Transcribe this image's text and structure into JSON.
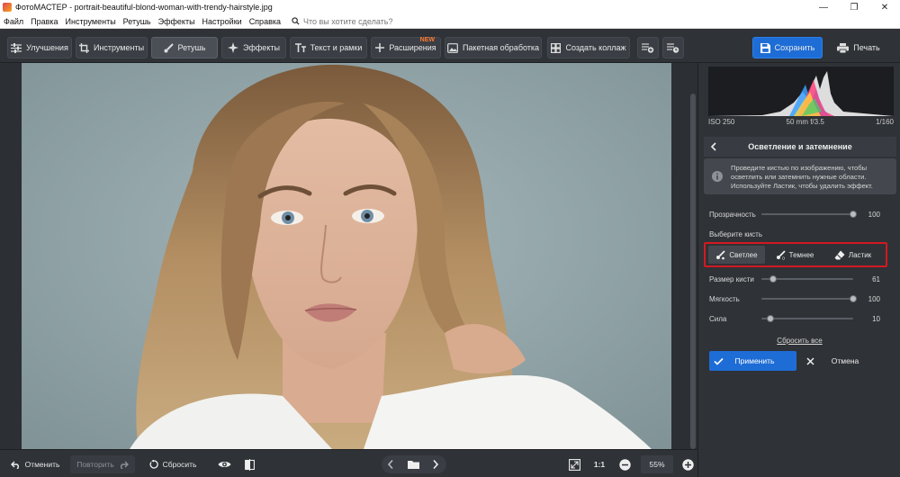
{
  "window": {
    "title": "ФотоМАСТЕР - portrait-beautiful-blond-woman-with-trendy-hairstyle.jpg",
    "minimize_glyph": "—",
    "restore_glyph": "❐",
    "close_glyph": "✕"
  },
  "menu": {
    "items": [
      "Файл",
      "Правка",
      "Инструменты",
      "Ретушь",
      "Эффекты",
      "Настройки",
      "Справка"
    ],
    "search_placeholder": "Что вы хотите сделать?"
  },
  "toolbar": {
    "tabs": [
      {
        "label": "Улучшения",
        "icon": "sliders-icon"
      },
      {
        "label": "Инструменты",
        "icon": "crop-icon"
      },
      {
        "label": "Ретушь",
        "icon": "brush-icon",
        "active": true
      },
      {
        "label": "Эффекты",
        "icon": "sparkle-icon"
      },
      {
        "label": "Текст и рамки",
        "icon": "text-icon"
      },
      {
        "label": "Расширения",
        "icon": "plus-icon",
        "badge": "NEW"
      },
      {
        "label": "Пакетная обработка",
        "icon": "image-stack-icon"
      },
      {
        "label": "Создать коллаж",
        "icon": "collage-icon"
      }
    ],
    "save_label": "Сохранить",
    "print_label": "Печать"
  },
  "histogram": {
    "iso": "ISO 250",
    "lens": "50 mm f/3.5",
    "shutter": "1/160"
  },
  "panel": {
    "title": "Осветление и затемнение",
    "info_lines": [
      "Проведите кистью по изображению, чтобы",
      "осветлить или затемнить нужные области.",
      "Используйте Ластик, чтобы удалить эффект."
    ],
    "opacity": {
      "label": "Прозрачность",
      "value": 100,
      "max": 100
    },
    "choose_brush_label": "Выберите кисть",
    "brushes": [
      {
        "label": "Светлее",
        "selected": true
      },
      {
        "label": "Темнее",
        "selected": false
      },
      {
        "label": "Ластик",
        "selected": false
      }
    ],
    "brush_size": {
      "label": "Размер кисти",
      "value": 61,
      "max": 100
    },
    "softness": {
      "label": "Мягкость",
      "value": 100,
      "max": 100
    },
    "strength": {
      "label": "Сила",
      "value": 10,
      "max": 100
    },
    "reset_all": "Сбросить все",
    "apply_label": "Применить",
    "cancel_label": "Отмена"
  },
  "bottom": {
    "undo": "Отменить",
    "redo": "Повторить",
    "reset": "Сбросить",
    "ratio": "1:1",
    "zoom": "55%"
  },
  "colors": {
    "accent": "#1e6dd6",
    "highlight_border": "#d21922",
    "new_badge": "#ff7a2f"
  }
}
